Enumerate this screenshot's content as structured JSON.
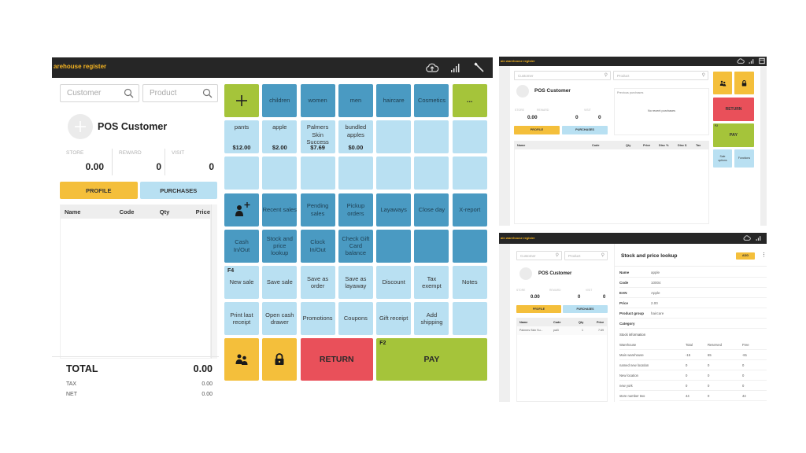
{
  "main": {
    "register_title": "arehouse register",
    "icons": [
      "cloud-upload-icon",
      "signal-icon",
      "wand-icon"
    ],
    "search": {
      "customer_placeholder": "Customer",
      "product_placeholder": "Product"
    },
    "customer": {
      "name": "POS Customer",
      "stats": [
        {
          "label": "STORE",
          "value": "0.00"
        },
        {
          "label": "REWARD",
          "value": "0"
        },
        {
          "label": "VISIT",
          "value": "0"
        }
      ],
      "profile_label": "PROFILE",
      "purchases_label": "PURCHASES"
    },
    "cart": {
      "columns": [
        "Name",
        "Code",
        "Qty",
        "Price"
      ]
    },
    "totals": {
      "total_label": "TOTAL",
      "total_value": "0.00",
      "tax_label": "TAX",
      "tax_value": "0.00",
      "net_label": "NET",
      "net_value": "0.00"
    },
    "categories": [
      "children",
      "women",
      "men",
      "haircare",
      "Cosmetics"
    ],
    "more_label": "...",
    "products": [
      {
        "name": "pants",
        "price": "$12.00"
      },
      {
        "name": "apple",
        "price": "$2.00"
      },
      {
        "name": "Palmers Skin Success",
        "price": "$7.69"
      },
      {
        "name": "bundled apples",
        "price": "$0.00"
      }
    ],
    "functions_row1": [
      "Recent sales",
      "Pending sales",
      "Pickup orders",
      "Layaways",
      "Close day",
      "X-report"
    ],
    "functions_row2": [
      "Cash In/Out",
      "Stock and price lookup",
      "Clock In/Out",
      "Check Gift Card balance"
    ],
    "sale_row1": {
      "fkey": "F4",
      "items": [
        "New sale",
        "Save sale",
        "Save as order",
        "Save as layaway",
        "Discount",
        "Tax exempt",
        "Notes"
      ]
    },
    "sale_row2": [
      "Print last receipt",
      "Open cash drawer",
      "Promotions",
      "Coupons",
      "Gift receipt",
      "Add shipping"
    ],
    "return_label": "RETURN",
    "pay_label": "PAY",
    "pay_fkey": "F2"
  },
  "top_right": {
    "register_title": "ain warehouse register",
    "customer_placeholder": "Customer",
    "product_placeholder": "Product",
    "customer_name": "POS Customer",
    "stats": [
      {
        "label": "STORE",
        "value": "0.00"
      },
      {
        "label": "REWARD",
        "value": "0"
      },
      {
        "label": "VISIT",
        "value": "0"
      }
    ],
    "profile_label": "PROFILE",
    "purchases_label": "PURCHASES",
    "previous_purchases_title": "Previous purchases",
    "no_purchases": "No recent purchases",
    "cart_columns": [
      "Name",
      "Code",
      "Qty",
      "Price",
      "Disc %",
      "Disc $",
      "Tax"
    ],
    "return_label": "RETURN",
    "pay_label": "PAY",
    "pay_fkey": "F2",
    "sale_options_label": "Sale options",
    "functions_label": "Functions"
  },
  "bottom_right": {
    "register_title": "ain warehouse register",
    "customer_placeholder": "Customer",
    "product_placeholder": "Product",
    "customer_name": "POS Customer",
    "stats": [
      {
        "label": "STORE",
        "value": "0.00"
      },
      {
        "label": "REWARD",
        "value": "0"
      },
      {
        "label": "VISIT",
        "value": "0"
      }
    ],
    "profile_label": "PROFILE",
    "purchases_label": "PURCHASES",
    "cart_columns": [
      "Name",
      "Code",
      "Qty",
      "Price"
    ],
    "cart_rows": [
      {
        "name": "Palmers Skin Su...",
        "code": "pal3",
        "qty": "1",
        "price": "7.69"
      }
    ],
    "lookup": {
      "title": "Stock and price lookup",
      "add_label": "ADD",
      "fields": [
        {
          "key": "Name",
          "value": "apple"
        },
        {
          "key": "Code",
          "value": "10004"
        },
        {
          "key": "EAN",
          "value": "Apple"
        },
        {
          "key": "Price",
          "value": "2.00"
        },
        {
          "key": "Product group",
          "value": "haircare"
        },
        {
          "key": "Category",
          "value": ""
        }
      ],
      "stock_title": "Stock information",
      "stock_columns": [
        "Warehouse",
        "Total",
        "Reserved",
        "Free"
      ],
      "stock_rows": [
        {
          "warehouse": "Main warehouse",
          "total": "-15",
          "reserved": "65",
          "free": "-81"
        },
        {
          "warehouse": "named new location",
          "total": "0",
          "reserved": "0",
          "free": "0"
        },
        {
          "warehouse": "New location",
          "total": "0",
          "reserved": "0",
          "free": "0"
        },
        {
          "warehouse": "new york",
          "total": "0",
          "reserved": "0",
          "free": "0"
        },
        {
          "warehouse": "store number two",
          "total": "44",
          "reserved": "0",
          "free": "44"
        }
      ]
    }
  }
}
